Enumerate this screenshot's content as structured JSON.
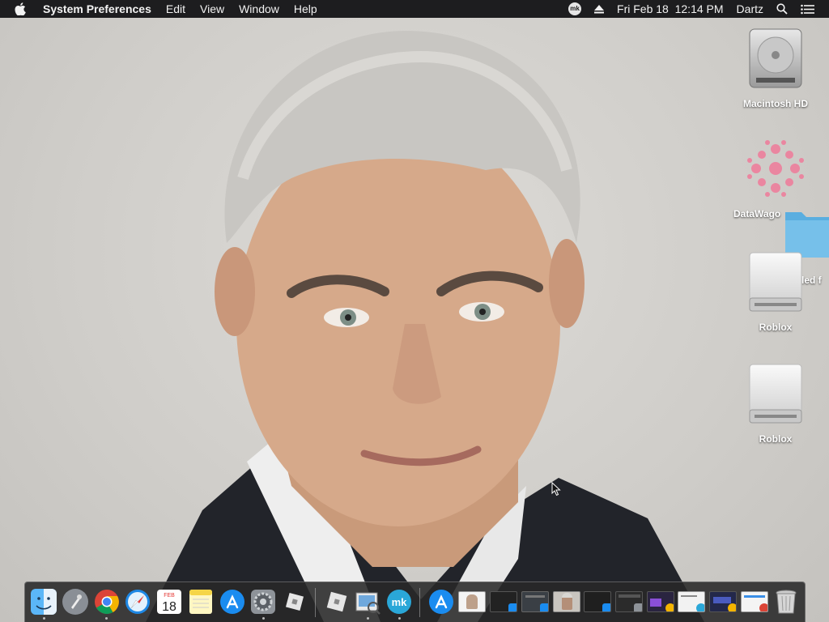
{
  "menubar": {
    "apple_icon": "apple-logo-icon",
    "app_name": "System Preferences",
    "menus": [
      "Edit",
      "View",
      "Window",
      "Help"
    ],
    "status": {
      "mk_badge": "mk",
      "eject_icon": "eject-icon",
      "datetime": "Fri Feb 18  12:14 PM",
      "user": "Dartz",
      "search_icon": "spotlight-search-icon",
      "notifications_icon": "notification-center-icon"
    }
  },
  "desktop": {
    "wallpaper": "portrait photo of a grey-haired man in dark suit",
    "icons": [
      {
        "label": "Macintosh HD",
        "icon": "hard-drive-icon"
      },
      {
        "label": "DataWago",
        "icon": "datawagon-app-icon"
      },
      {
        "label": "led f",
        "icon": "folder-icon"
      },
      {
        "label": "Roblox",
        "icon": "disk-image-icon"
      },
      {
        "label": "Roblox",
        "icon": "disk-image-icon"
      }
    ]
  },
  "dock": {
    "calendar": {
      "month": "FEB",
      "day": "18"
    },
    "apps": [
      {
        "name": "Finder",
        "icon": "finder-icon",
        "running": true
      },
      {
        "name": "Launchpad",
        "icon": "launchpad-icon",
        "running": false
      },
      {
        "name": "Google Chrome",
        "icon": "chrome-icon",
        "running": true
      },
      {
        "name": "Safari",
        "icon": "safari-icon",
        "running": false
      },
      {
        "name": "Calendar",
        "icon": "calendar-icon",
        "running": false
      },
      {
        "name": "Notes",
        "icon": "notes-icon",
        "running": false
      },
      {
        "name": "App Store",
        "icon": "app-store-icon",
        "running": false
      },
      {
        "name": "System Preferences",
        "icon": "system-preferences-icon",
        "running": true
      },
      {
        "name": "Roblox",
        "icon": "roblox-icon",
        "running": false
      },
      {
        "name": "Roblox Studio",
        "icon": "roblox-studio-icon",
        "running": false
      },
      {
        "name": "Preview",
        "icon": "preview-icon",
        "running": true
      },
      {
        "name": "mk",
        "icon": "mk-app-icon",
        "running": true
      }
    ],
    "minimized": [
      {
        "icon": "app-store-minimized-icon"
      },
      {
        "icon": "portrait-document-minimized-icon"
      },
      {
        "icon": "window-minimized-icon"
      },
      {
        "icon": "window-minimized-icon"
      },
      {
        "icon": "portrait-window-minimized-icon"
      },
      {
        "icon": "window-minimized-icon"
      },
      {
        "icon": "window-minimized-icon"
      },
      {
        "icon": "chrome-window-minimized-icon"
      },
      {
        "icon": "window-minimized-icon"
      },
      {
        "icon": "window-minimized-icon"
      },
      {
        "icon": "chrome-window-minimized-icon"
      }
    ],
    "trash": {
      "name": "Trash",
      "icon": "trash-icon"
    }
  },
  "colors": {
    "menubar_bg": "#1d1d1f",
    "accent_blue": "#3a8ee6",
    "folder_blue": "#5aaee0"
  }
}
